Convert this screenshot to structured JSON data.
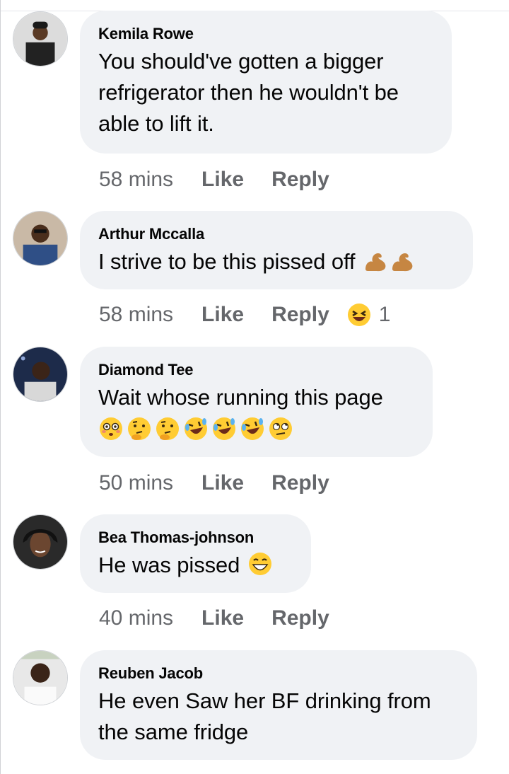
{
  "comments": [
    {
      "name": "Kemila Rowe",
      "text_lines": [
        "You should've gotten a bigger",
        "refrigerator then he wouldn't be",
        "able to lift it."
      ],
      "time": "58 mins",
      "like": "Like",
      "reply": "Reply"
    },
    {
      "name": "Arthur Mccalla",
      "text": "I strive to be this pissed off",
      "time": "58 mins",
      "like": "Like",
      "reply": "Reply",
      "reaction_count": "1"
    },
    {
      "name": "Diamond Tee",
      "text": "Wait whose running this page",
      "time": "50 mins",
      "like": "Like",
      "reply": "Reply"
    },
    {
      "name": "Bea Thomas-johnson",
      "text": "He was pissed",
      "time": "40 mins",
      "like": "Like",
      "reply": "Reply"
    },
    {
      "name": "Reuben Jacob",
      "text_lines": [
        "He even Saw her BF drinking from",
        "the same fridge"
      ]
    }
  ],
  "colors": {
    "bubble": "#f0f2f5",
    "text": "#050505",
    "meta": "#65676b",
    "emoji_yellow": "#ffcc33"
  }
}
